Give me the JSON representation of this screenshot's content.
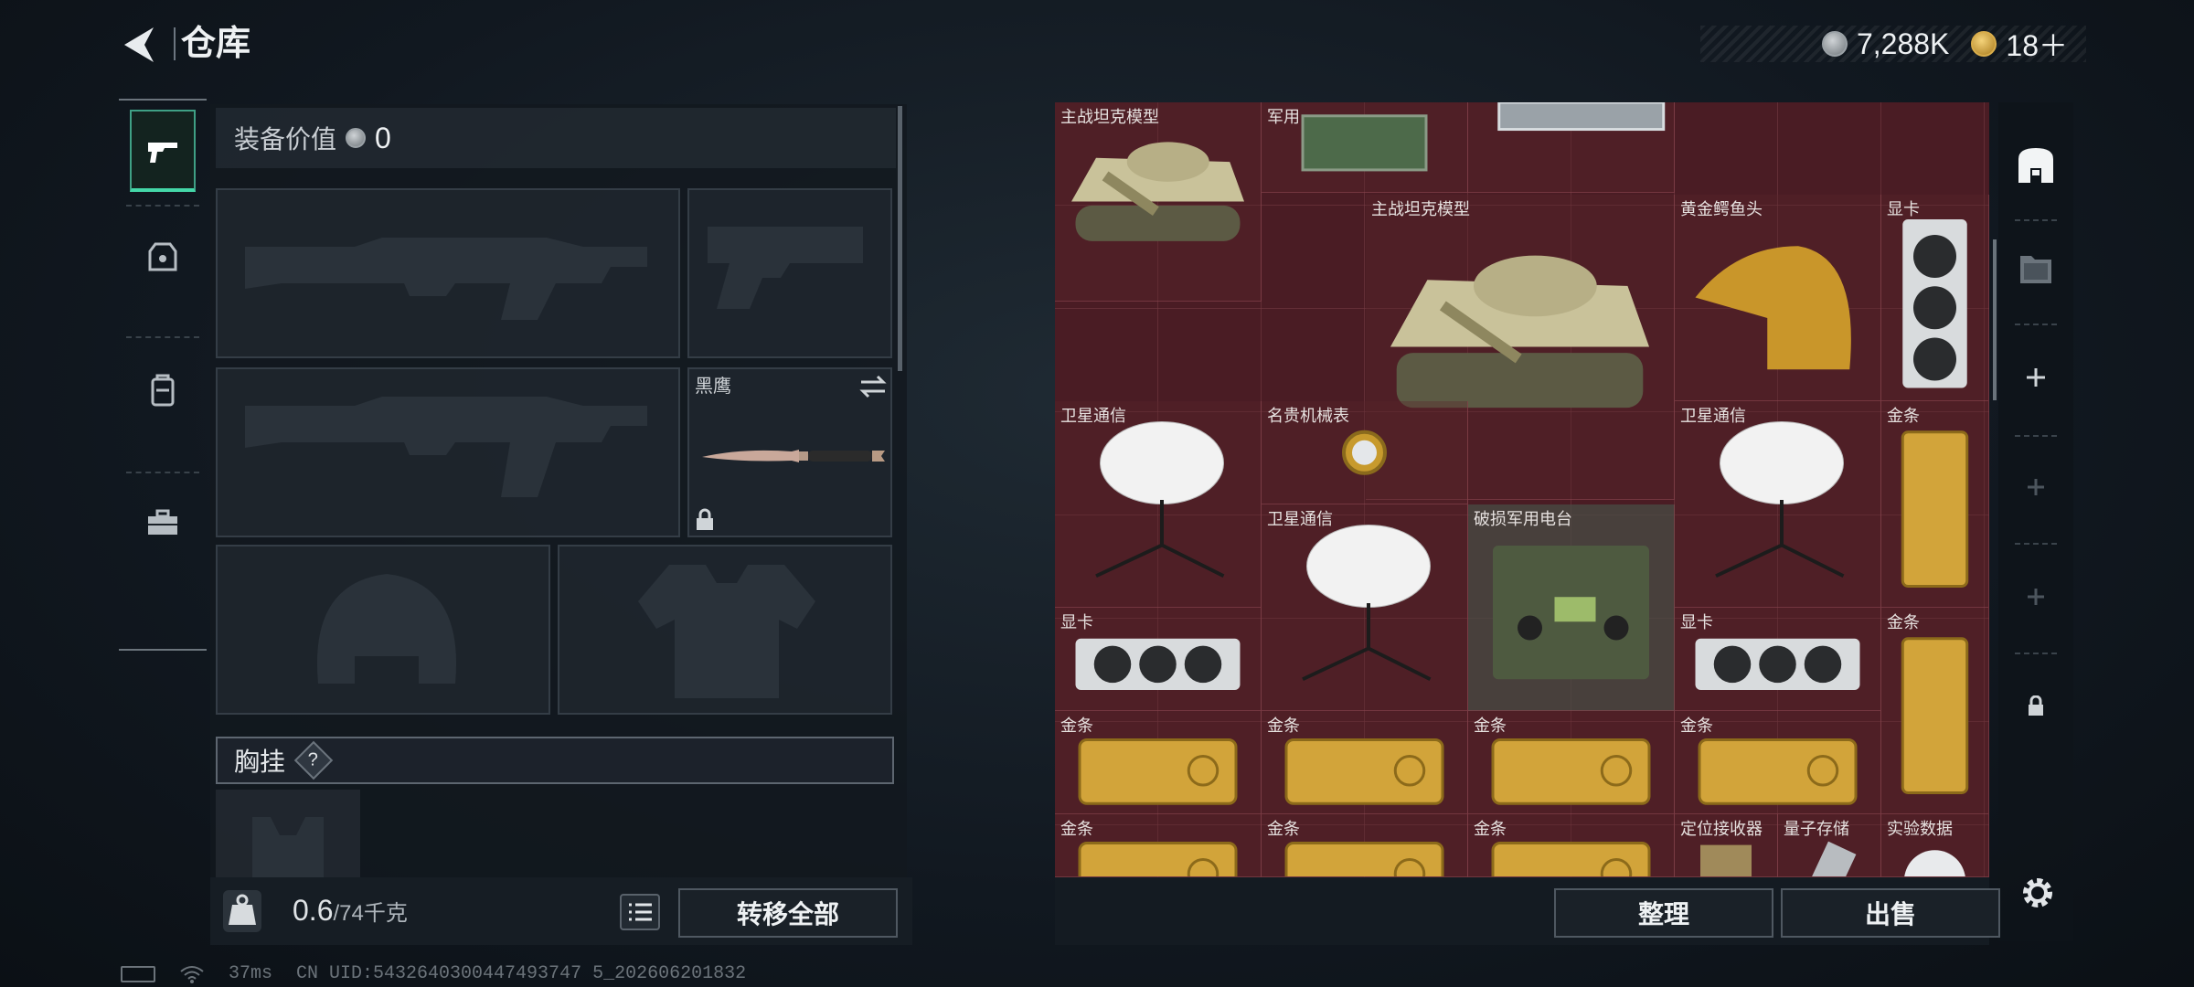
{
  "header": {
    "title": "仓库"
  },
  "currency": [
    {
      "icon": "silver-coin-icon",
      "value": "7,288K"
    },
    {
      "icon": "gold-coin-icon",
      "value": "18＋"
    }
  ],
  "equipment": {
    "value_label": "装备价值",
    "value": "0",
    "knife_name": "黑鹰",
    "chest_rig_label": "胸挂",
    "chest_rig_help": "?"
  },
  "carry": {
    "weight": "0.6",
    "max": "/74千克",
    "transfer_label": "转移全部"
  },
  "stash": {
    "sort_label": "整理",
    "sell_label": "出售",
    "items": [
      {
        "name": "主战坦克模型",
        "kind": "tank"
      },
      {
        "name": "军用",
        "kind": "chip"
      },
      {
        "name": "",
        "kind": "server"
      },
      {
        "name": "主战坦克模型",
        "kind": "tank"
      },
      {
        "name": "黄金鳄鱼头",
        "kind": "croc"
      },
      {
        "name": "显卡",
        "kind": "gpu-v"
      },
      {
        "name": "卫星通信",
        "kind": "dish"
      },
      {
        "name": "名贵机械表",
        "kind": "watch"
      },
      {
        "name": "卫星通信",
        "kind": "dish"
      },
      {
        "name": "金条",
        "kind": "gold-v"
      },
      {
        "name": "卫星通信",
        "kind": "dish"
      },
      {
        "name": "破损军用电台",
        "kind": "radio"
      },
      {
        "name": "显卡",
        "kind": "gpu-h"
      },
      {
        "name": "显卡",
        "kind": "gpu-h"
      },
      {
        "name": "金条",
        "kind": "gold-v"
      },
      {
        "name": "金条",
        "kind": "gold-h"
      },
      {
        "name": "金条",
        "kind": "gold-h"
      },
      {
        "name": "金条",
        "kind": "gold-h"
      },
      {
        "name": "金条",
        "kind": "gold-h"
      },
      {
        "name": "金条",
        "kind": "gold-h"
      },
      {
        "name": "金条",
        "kind": "gold-h"
      },
      {
        "name": "金条",
        "kind": "gold-h"
      },
      {
        "name": "定位接收器",
        "kind": "receiver"
      },
      {
        "name": "量子存储",
        "kind": "quantum"
      },
      {
        "name": "实验数据",
        "kind": "disc"
      }
    ]
  },
  "status_bar": {
    "ping": "37ms",
    "uid": "CN UID:5432640300447493747 5_202606201832"
  }
}
